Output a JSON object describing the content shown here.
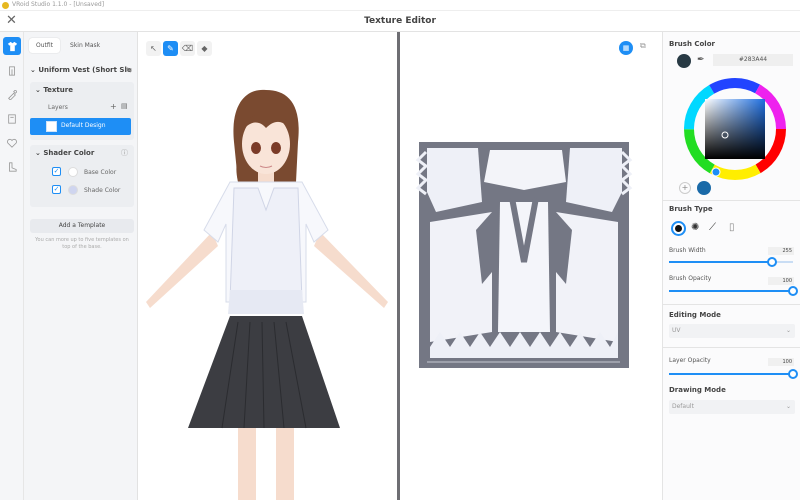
{
  "app": {
    "titlebar": "VRoid Studio 1.1.0 - [Unsaved]",
    "title": "Texture Editor"
  },
  "left_panel": {
    "tabs": [
      "Outfit",
      "Skin Mask"
    ],
    "outfit_name": "Uniform Vest (Short Sle",
    "texture_section": "Texture",
    "layers_label": "Layers",
    "selected_layer": "Default Design",
    "shader_section": "Shader Color",
    "base_color": "Base Color",
    "shade_color": "Shade Color",
    "add_template": "Add a Template",
    "help_text": "You can more up to five templates on top of the base."
  },
  "right_panel": {
    "brush_color_label": "Brush Color",
    "hex_value": "#283A44",
    "brush_type_label": "Brush Type",
    "brush_width_label": "Brush Width",
    "brush_width_value": "255",
    "brush_opacity_label": "Brush Opacity",
    "brush_opacity_value": "100",
    "editing_mode_label": "Editing Mode",
    "editing_mode_value": "UV",
    "layer_opacity_label": "Layer Opacity",
    "layer_opacity_value": "100",
    "drawing_mode_label": "Drawing Mode",
    "drawing_mode_value": "Default"
  },
  "levels": {
    "brush_width": 0.83,
    "brush_opacity": 1.0,
    "layer_opacity": 1.0
  },
  "colors": {
    "accent": "#1e8ef5",
    "brush": "#283A44",
    "divider": "#6e6e73",
    "uv_bg": "#747784"
  },
  "icons": [
    "close-icon",
    "outfit-icon",
    "select-icon",
    "pen-icon",
    "eraser-icon",
    "fill-icon",
    "eyedropper-icon",
    "gear-icon"
  ]
}
